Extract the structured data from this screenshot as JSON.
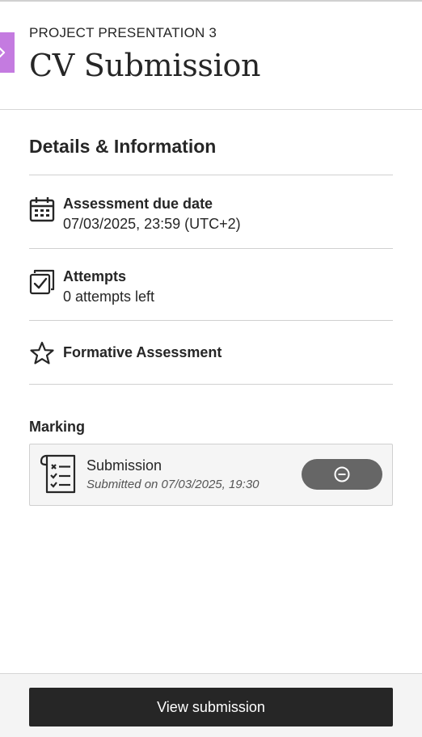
{
  "header": {
    "eyebrow": "PROJECT PRESENTATION 3",
    "title": "CV Submission",
    "close_icon": "chevron-right-icon",
    "accent_color": "#c47be0"
  },
  "details": {
    "section_title": "Details & Information",
    "due_date": {
      "icon": "calendar-icon",
      "label": "Assessment due date",
      "value": "07/03/2025, 23:59 (UTC+2)"
    },
    "attempts": {
      "icon": "attempts-icon",
      "label": "Attempts",
      "value": "0 attempts left"
    },
    "formative": {
      "icon": "star-icon",
      "label": "Formative Assessment"
    }
  },
  "marking": {
    "label": "Marking",
    "submission": {
      "icon": "checklist-document-icon",
      "title": "Submission",
      "meta": "Submitted on 07/03/2025, 19:30",
      "status_icon": "minus-circle-icon"
    }
  },
  "footer": {
    "view_button_label": "View submission"
  }
}
